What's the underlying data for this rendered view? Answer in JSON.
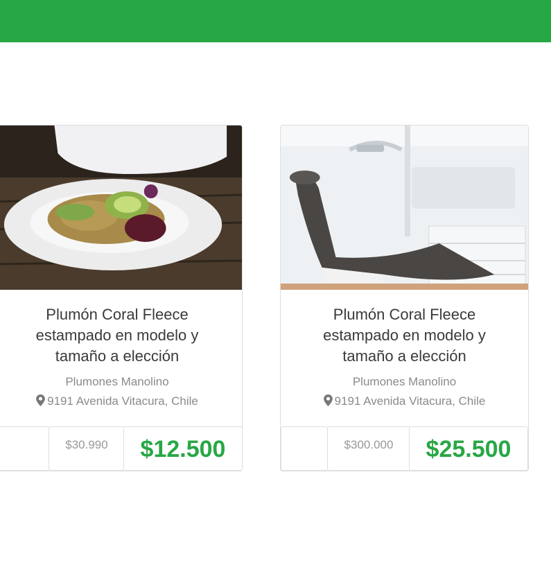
{
  "colors": {
    "brand": "#28a745"
  },
  "products": [
    {
      "image_icon": "salad-bowl-photo",
      "title_lines": [
        "Plumón Coral Fleece",
        "estampado en modelo y",
        "tamaño a elección"
      ],
      "vendor": "Plumones Manolino",
      "location_icon": "map-marker-icon",
      "address": "9191 Avenida Vitacura, Chile",
      "old_price": "$30.990",
      "price": "$12.500"
    },
    {
      "image_icon": "dental-chair-photo",
      "title_lines": [
        "Plumón Coral Fleece",
        "estampado en modelo y",
        "tamaño a elección"
      ],
      "vendor": "Plumones Manolino",
      "location_icon": "map-marker-icon",
      "address": "9191 Avenida Vitacura, Chile",
      "old_price": "$300.000",
      "price": "$25.500"
    }
  ]
}
